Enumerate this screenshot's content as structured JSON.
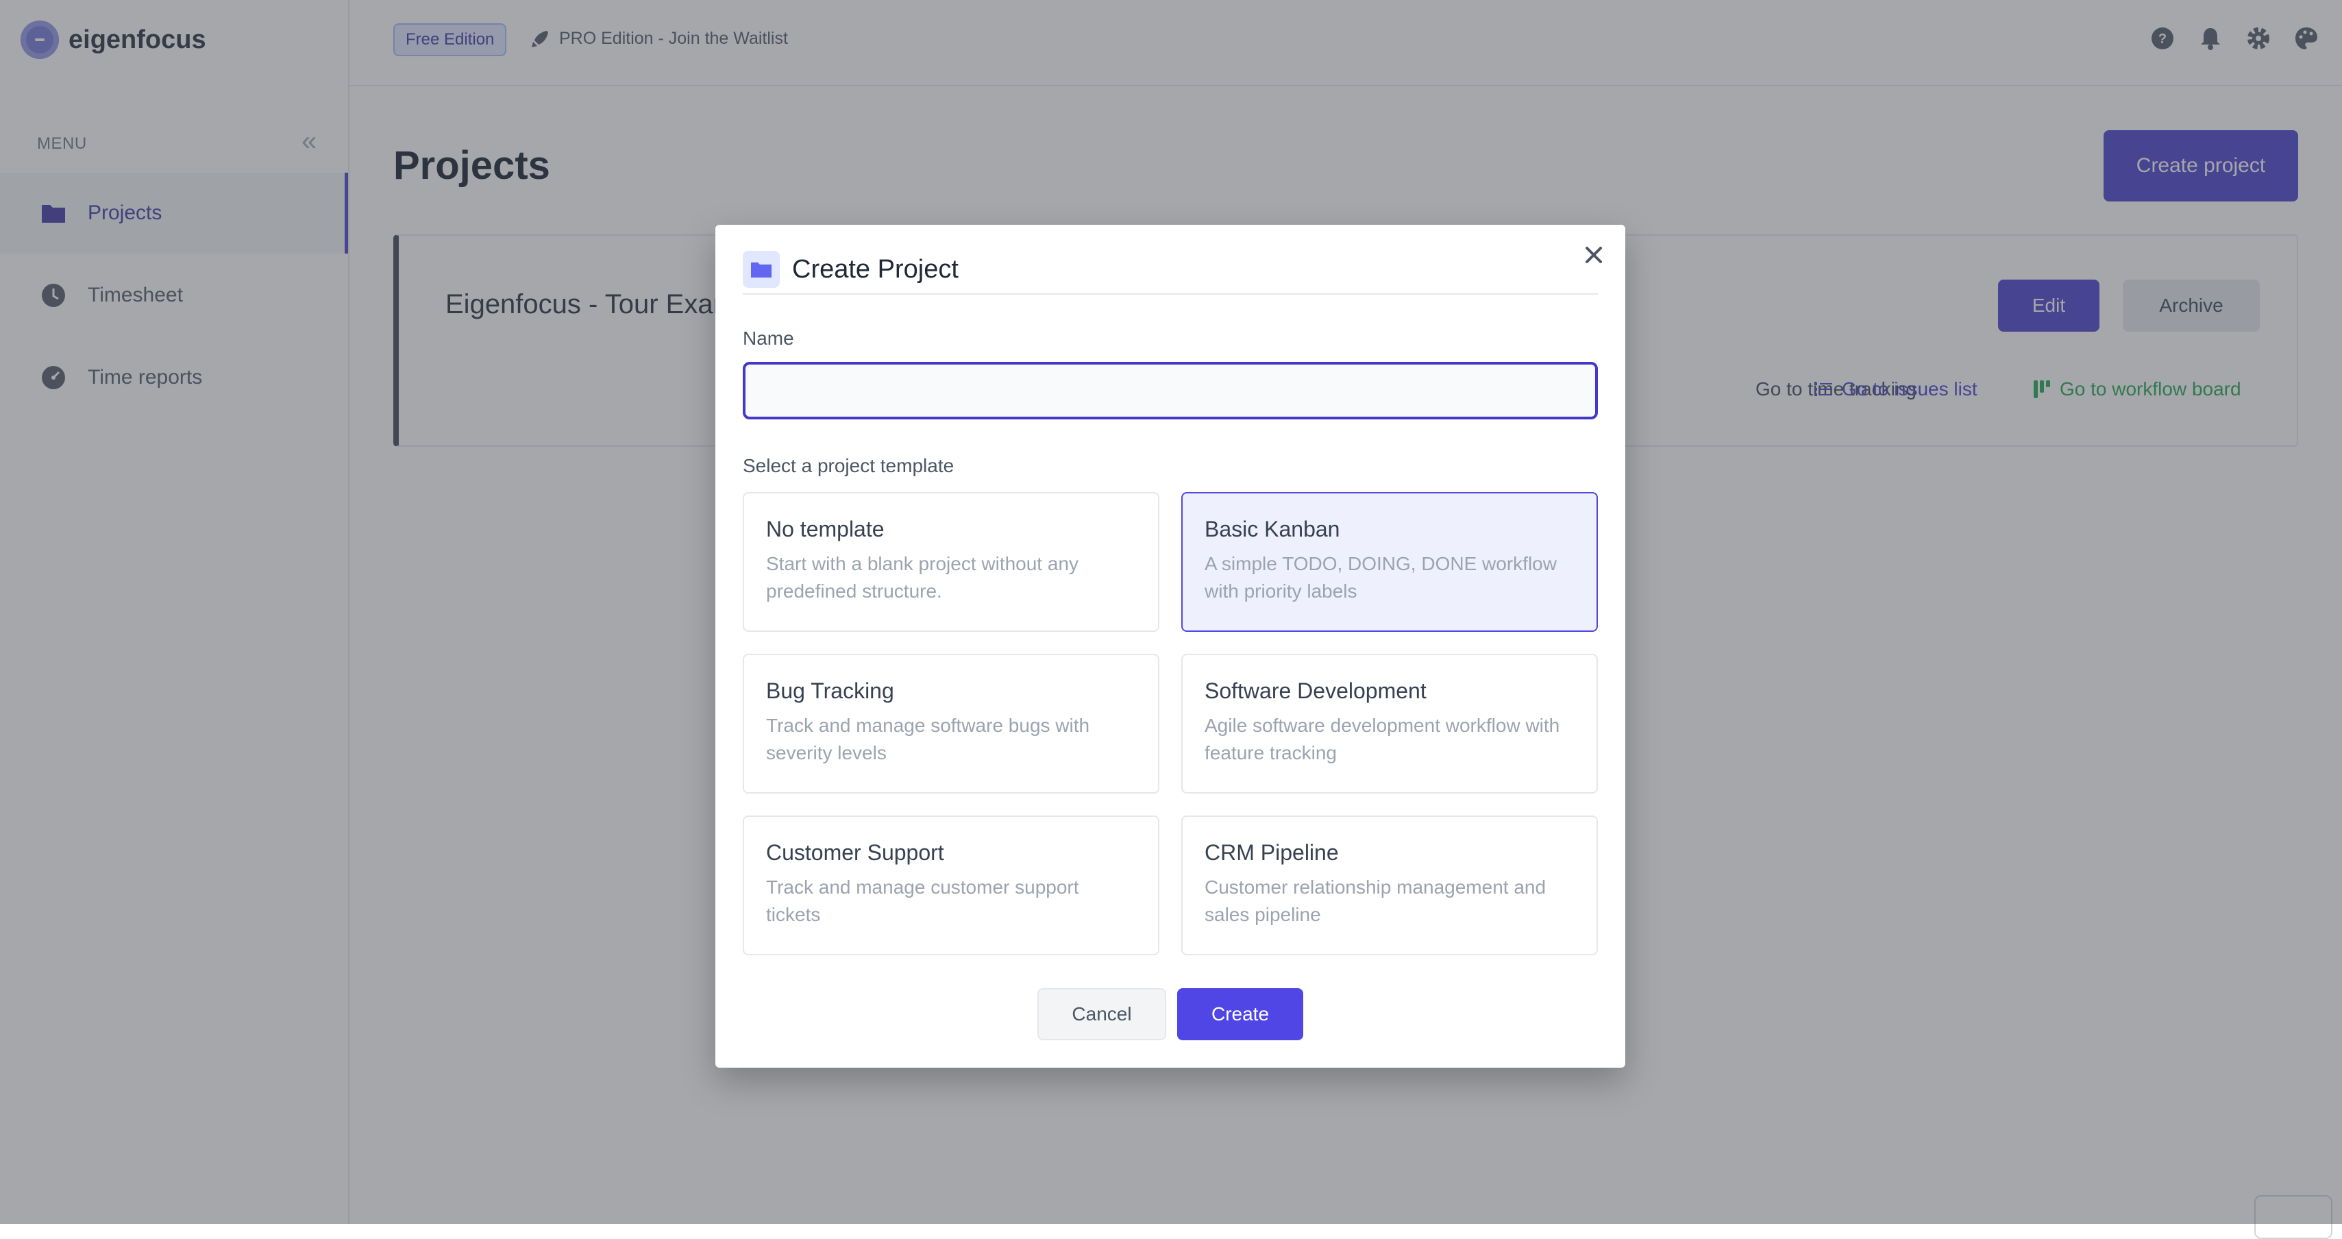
{
  "app": {
    "name": "eigenfocus",
    "menu_label": "MENU",
    "nav": [
      {
        "label": "Projects",
        "icon": "folder-icon",
        "active": true
      },
      {
        "label": "Timesheet",
        "icon": "clock-icon",
        "active": false
      },
      {
        "label": "Time reports",
        "icon": "gauge-icon",
        "active": false
      }
    ]
  },
  "topbar": {
    "edition_badge": "Free Edition",
    "pro_link": "PRO Edition - Join the Waitlist",
    "icons": [
      "help-icon",
      "bell-icon",
      "gear-icon",
      "palette-icon"
    ]
  },
  "page": {
    "title": "Projects",
    "create_button": "Create project",
    "project": {
      "name": "Eigenfocus - Tour Example",
      "edit": "Edit",
      "archive": "Archive",
      "link_time": "Go to time tracking",
      "link_issues": "Go to issues list",
      "link_board": "Go to workflow board"
    }
  },
  "modal": {
    "title": "Create Project",
    "name_label": "Name",
    "name_value": "",
    "template_label": "Select a project template",
    "templates": [
      {
        "name": "No template",
        "description": "Start with a blank project without any predefined structure.",
        "selected": false
      },
      {
        "name": "Basic Kanban",
        "description": "A simple TODO, DOING, DONE workflow with priority labels",
        "selected": true
      },
      {
        "name": "Bug Tracking",
        "description": "Track and manage software bugs with severity levels",
        "selected": false
      },
      {
        "name": "Software Development",
        "description": "Agile software development workflow with feature tracking",
        "selected": false
      },
      {
        "name": "Customer Support",
        "description": "Track and manage customer support tickets",
        "selected": false
      },
      {
        "name": "CRM Pipeline",
        "description": "Customer relationship management and sales pipeline",
        "selected": false
      }
    ],
    "cancel": "Cancel",
    "create": "Create"
  },
  "colors": {
    "accent": "#4338ca",
    "accent_light": "#4f46e5",
    "selected_bg": "#eef0fd",
    "link_green": "#16a34a"
  }
}
